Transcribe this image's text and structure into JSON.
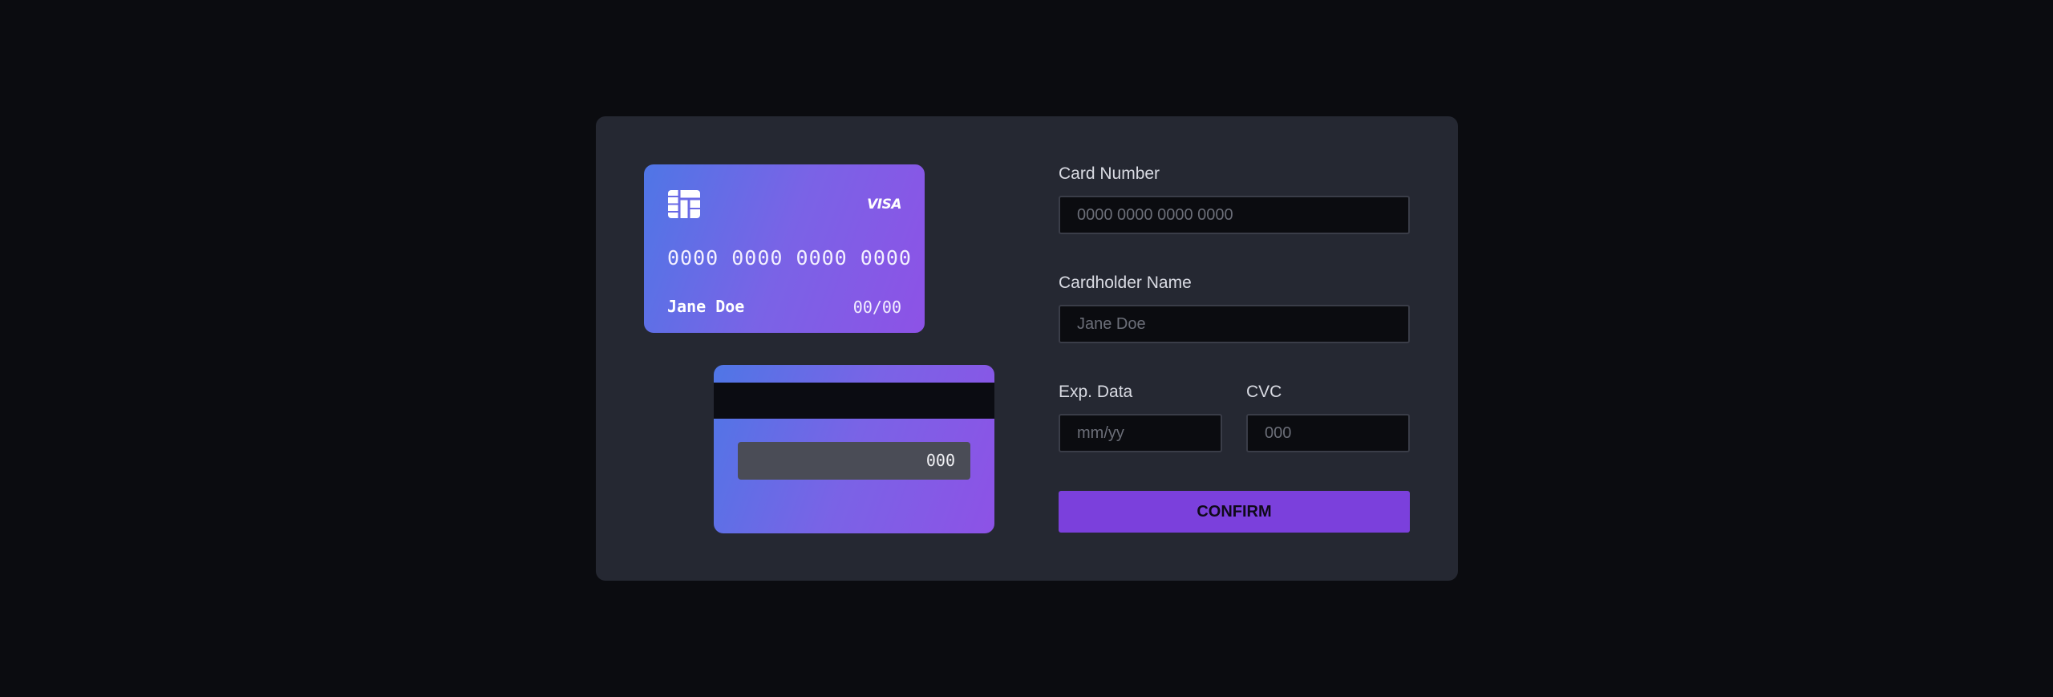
{
  "card_front": {
    "brand": "VISA",
    "number": "0000 0000 0000 0000",
    "holder": "Jane Doe",
    "expiry": "00/00"
  },
  "card_back": {
    "cvc": "000"
  },
  "form": {
    "card_number": {
      "label": "Card Number",
      "placeholder": "0000 0000 0000 0000",
      "value": ""
    },
    "cardholder_name": {
      "label": "Cardholder Name",
      "placeholder": "Jane Doe",
      "value": ""
    },
    "exp_date": {
      "label": "Exp. Data",
      "placeholder": "mm/yy",
      "value": ""
    },
    "cvc": {
      "label": "CVC",
      "placeholder": "000",
      "value": ""
    },
    "confirm_label": "CONFIRM"
  },
  "colors": {
    "background": "#0b0c10",
    "panel": "#252832",
    "card_gradient_start": "#4f76e6",
    "card_gradient_end": "#8d52e6",
    "accent": "#7b40dc"
  },
  "icons": {
    "chip": "card-chip-icon",
    "brand": "visa-logo"
  }
}
